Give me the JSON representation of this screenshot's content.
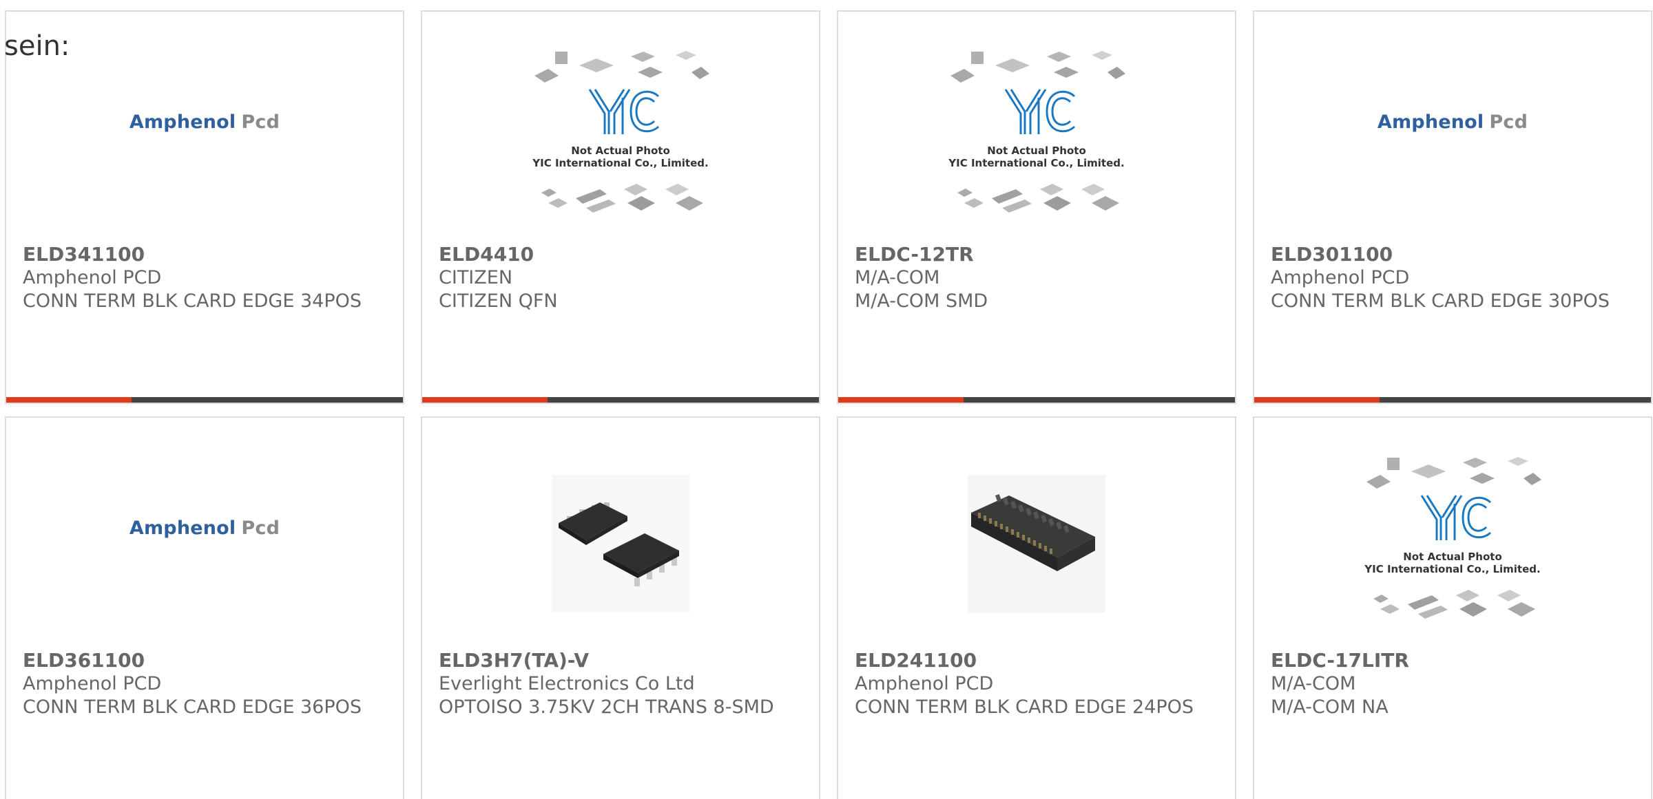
{
  "intro": {
    "text": "sein:"
  },
  "cards": [
    {
      "part_number": "ELD341100",
      "manufacturer": "Amphenol PCD",
      "description": "CONN TERM BLK CARD EDGE 34POS",
      "image_type": "amphenol-logo",
      "logo_text_1": "Amphenol",
      "logo_text_2": "Pcd",
      "has_bar": true
    },
    {
      "part_number": "ELD4410",
      "manufacturer": "CITIZEN",
      "description": "CITIZEN QFN",
      "image_type": "yic-placeholder",
      "caption_1": "Not Actual Photo",
      "caption_2": "YIC International Co., Limited.",
      "has_bar": true
    },
    {
      "part_number": "ELDC-12TR",
      "manufacturer": "M/A-COM",
      "description": "M/A-COM SMD",
      "image_type": "yic-placeholder",
      "caption_1": "Not Actual Photo",
      "caption_2": "YIC International Co., Limited.",
      "has_bar": true
    },
    {
      "part_number": "ELD301100",
      "manufacturer": "Amphenol PCD",
      "description": "CONN TERM BLK CARD EDGE 30POS",
      "image_type": "amphenol-logo",
      "logo_text_1": "Amphenol",
      "logo_text_2": "Pcd",
      "has_bar": true
    },
    {
      "part_number": "ELD361100",
      "manufacturer": "Amphenol PCD",
      "description": "CONN TERM BLK CARD EDGE 36POS",
      "image_type": "amphenol-logo",
      "logo_text_1": "Amphenol",
      "logo_text_2": "Pcd",
      "has_bar": false
    },
    {
      "part_number": "ELD3H7(TA)-V",
      "manufacturer": "Everlight Electronics Co Ltd",
      "description": "OPTOISO 3.75KV 2CH TRANS 8-SMD",
      "image_type": "ic-photo",
      "has_bar": false
    },
    {
      "part_number": "ELD241100",
      "manufacturer": "Amphenol PCD",
      "description": "CONN TERM BLK CARD EDGE 24POS",
      "image_type": "connector-photo",
      "has_bar": false
    },
    {
      "part_number": "ELDC-17LITR",
      "manufacturer": "M/A-COM",
      "description": "M/A-COM NA",
      "image_type": "yic-placeholder",
      "caption_1": "Not Actual Photo",
      "caption_2": "YIC International Co., Limited.",
      "has_bar": false
    }
  ],
  "colors": {
    "accent": "#e03a1c",
    "bar": "#444444",
    "text": "#666666",
    "amphenol_blue": "#2e5f9e",
    "yic_blue": "#1a78c2"
  }
}
